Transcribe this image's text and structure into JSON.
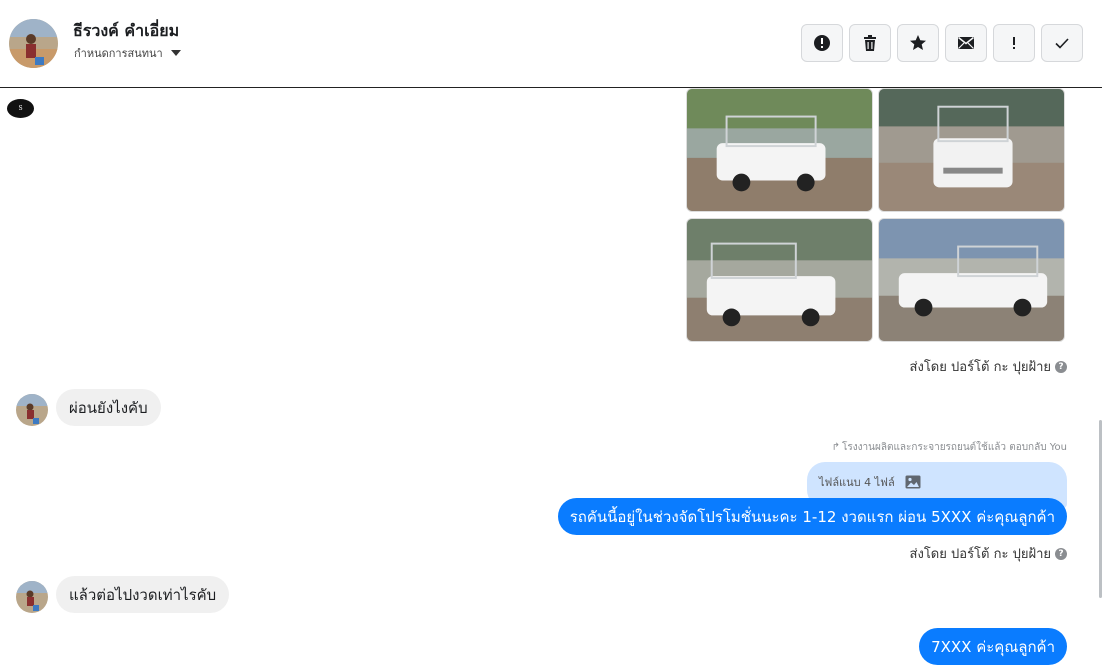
{
  "header": {
    "contact_name": "ธีรวงค์ คำเอี่ยม",
    "contact_subtitle": "กำหนดการสนทนา",
    "actions": [
      {
        "name": "spam",
        "icon": "alert-circle-icon"
      },
      {
        "name": "delete",
        "icon": "trash-icon"
      },
      {
        "name": "star",
        "icon": "star-icon"
      },
      {
        "name": "mark-unread",
        "icon": "envelope-icon"
      },
      {
        "name": "follow-up",
        "icon": "exclamation-icon"
      },
      {
        "name": "done",
        "icon": "check-icon"
      }
    ]
  },
  "messages": {
    "photo_sent_by": "ส่งโดย ปอร์โต้ กะ ปุยฝ้าย",
    "customer_msg_1": "ผ่อนยังไงคับ",
    "reply_note": "โรงงานผลิตและกระจายรถยนต์ใช้แล้ว ตอบกลับ You",
    "reply_quote": "ไฟล์แนบ 4 ไฟล์",
    "page_msg_1": "รถคันนี้อยู่ในช่วงจัดโปรโมชั่นนะคะ 1-12 งวดแรก ผ่อน 5XXX ค่ะคุณลูกค้า",
    "page_msg_1_sent_by": "ส่งโดย ปอร์โต้ กะ ปุยฝ้าย",
    "customer_msg_2": "แล้วต่อไปงวดเท่าไรคับ",
    "page_msg_2": "7XXX ค่ะคุณลูกค้า"
  },
  "colors": {
    "outgoing_bubble": "#0a7cff",
    "incoming_bubble": "#f0f0f0",
    "reply_quote_bg": "#cfe4ff"
  }
}
